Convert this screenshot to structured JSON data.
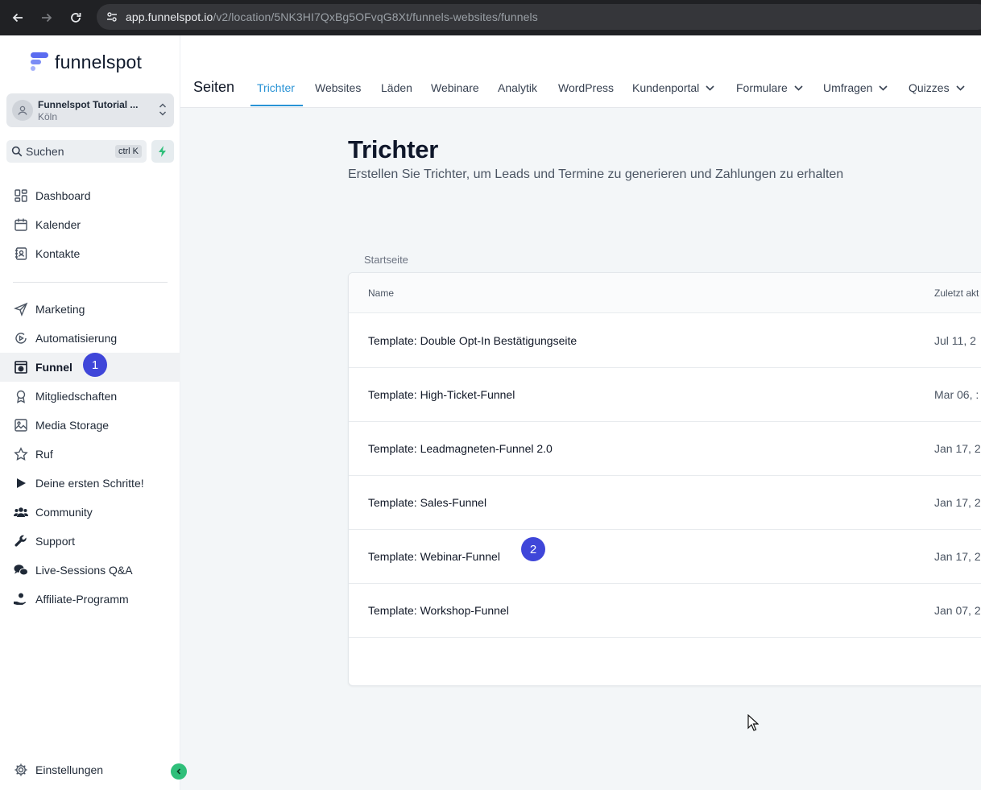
{
  "browser": {
    "url_host": "app.funnelspot.io",
    "url_path": "/v2/location/5NK3HI7QxBg5OFvqG8Xt/funnels-websites/funnels"
  },
  "sidebar": {
    "brand": "funnelspot",
    "account": {
      "name": "Funnelspot Tutorial ...",
      "location": "Köln"
    },
    "search": {
      "label": "Suchen",
      "shortcut": "ctrl K"
    },
    "items": [
      {
        "label": "Dashboard",
        "icon": "dashboard-icon"
      },
      {
        "label": "Kalender",
        "icon": "calendar-icon"
      },
      {
        "label": "Kontakte",
        "icon": "contacts-icon"
      },
      {
        "label": "Marketing",
        "icon": "send-icon"
      },
      {
        "label": "Automatisierung",
        "icon": "automation-icon"
      },
      {
        "label": "Funnel",
        "icon": "funnel-icon",
        "active": true
      },
      {
        "label": "Mitgliedschaften",
        "icon": "award-icon"
      },
      {
        "label": "Media Storage",
        "icon": "image-icon"
      },
      {
        "label": "Ruf",
        "icon": "star-icon"
      },
      {
        "label": "Deine ersten Schritte!",
        "icon": "play-icon"
      },
      {
        "label": "Community",
        "icon": "users-icon"
      },
      {
        "label": "Support",
        "icon": "wrench-icon"
      },
      {
        "label": "Live-Sessions Q&A",
        "icon": "chat-icon"
      },
      {
        "label": "Affiliate-Programm",
        "icon": "hand-coin-icon"
      }
    ],
    "settings": "Einstellungen",
    "funnel_badge": "1"
  },
  "topnav": {
    "title": "Seiten",
    "tabs": [
      {
        "label": "Trichter",
        "active": true
      },
      {
        "label": "Websites"
      },
      {
        "label": "Läden"
      },
      {
        "label": "Webinare"
      },
      {
        "label": "Analytik"
      },
      {
        "label": "WordPress"
      },
      {
        "label": "Kundenportal",
        "dropdown": true
      },
      {
        "label": "Formulare",
        "dropdown": true
      },
      {
        "label": "Umfragen",
        "dropdown": true
      },
      {
        "label": "Quizzes",
        "dropdown": true
      }
    ]
  },
  "main": {
    "heading": "Trichter",
    "subtitle": "Erstellen Sie Trichter, um Leads und Termine zu generieren und Zahlungen zu erhalten",
    "breadcrumb": "Startseite",
    "columns": [
      "Name",
      "Zuletzt akt"
    ],
    "rows": [
      {
        "name": "Template: Double Opt-In Bestätigungseite",
        "updated": "Jul 11, 2"
      },
      {
        "name": "Template: High-Ticket-Funnel",
        "updated": "Mar 06, :"
      },
      {
        "name": "Template: Leadmagneten-Funnel 2.0",
        "updated": "Jan 17, 2"
      },
      {
        "name": "Template: Sales-Funnel",
        "updated": "Jan 17, 2"
      },
      {
        "name": "Template: Webinar-Funnel",
        "updated": "Jan 17, 2"
      },
      {
        "name": "Template: Workshop-Funnel",
        "updated": "Jan 07, 2"
      }
    ],
    "row_badge": "2"
  },
  "colors": {
    "accent": "#2a93d5",
    "badge": "#3f46d9",
    "brand_green": "#2fbf7a"
  }
}
